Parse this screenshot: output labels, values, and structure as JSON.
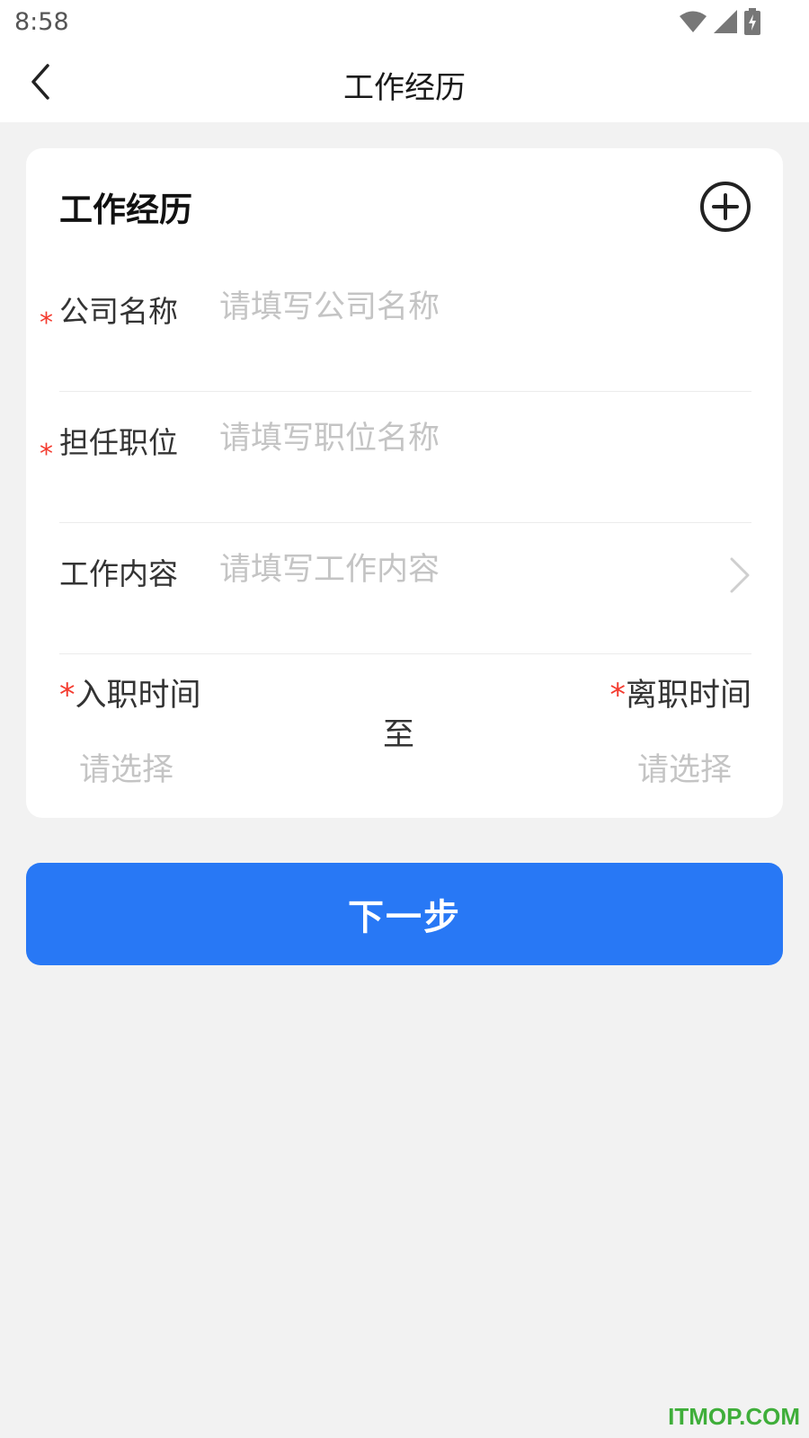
{
  "status_bar": {
    "time": "8:58",
    "icons": [
      "wifi-icon",
      "signal-icon",
      "battery-charging-icon"
    ]
  },
  "nav": {
    "title": "工作经历",
    "back_icon": "chevron-left-icon"
  },
  "card": {
    "title": "工作经历",
    "add_icon": "plus-circle-icon",
    "fields": [
      {
        "required": true,
        "required_mark": "*",
        "label": "公司名称",
        "placeholder": "请填写公司名称",
        "value": ""
      },
      {
        "required": true,
        "required_mark": "*",
        "label": "担任职位",
        "placeholder": "请填写职位名称",
        "value": ""
      },
      {
        "required": false,
        "label": "工作内容",
        "placeholder": "请填写工作内容",
        "value": "",
        "trailing_icon": "chevron-right-icon"
      }
    ],
    "dates": {
      "start_required_mark": "*",
      "start_label": "入职时间",
      "start_value": "请选择",
      "separator": "至",
      "end_required_mark": "*",
      "end_label": "离职时间",
      "end_value": "请选择"
    }
  },
  "next_button": {
    "label": "下一步"
  },
  "watermark": "ITMOP.COM",
  "colors": {
    "primary": "#2878f5",
    "required": "#f43b2f",
    "placeholder": "#c4c4c4",
    "background": "#f2f2f2",
    "watermark": "#3fae3a"
  }
}
